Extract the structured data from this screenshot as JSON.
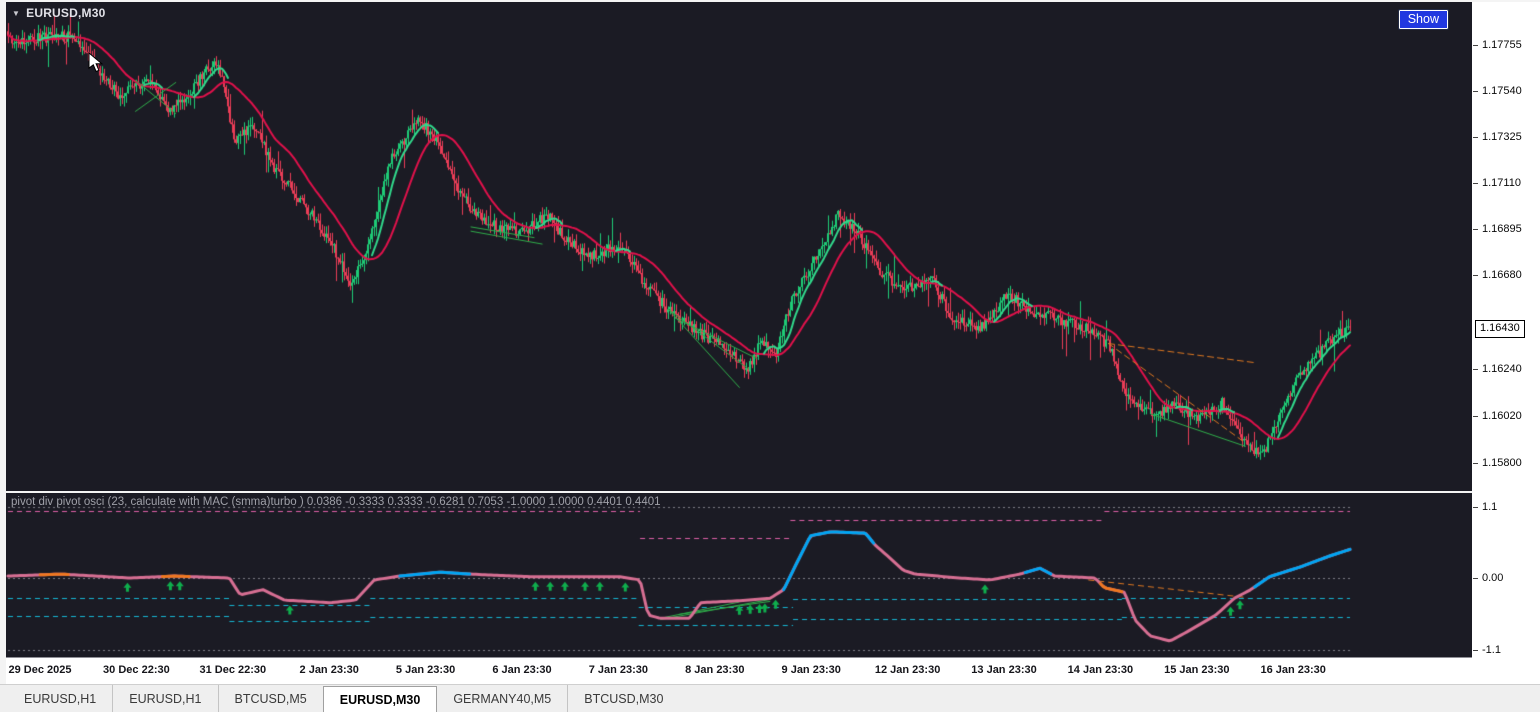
{
  "window": {
    "symbol_label": "EURUSD,M30",
    "show_button_label": "Show"
  },
  "icons": {
    "symbol_dropdown": "▼"
  },
  "main_chart": {
    "price_labels": [
      "1.17755",
      "1.17540",
      "1.17325",
      "1.17110",
      "1.16895",
      "1.16680",
      "1.16240",
      "1.16020",
      "1.15800"
    ],
    "current_price": "1.16430"
  },
  "indicator": {
    "label": "pivot div pivot osci (23, calculate with MAC (smma)turbo ) 0.0386 -0.3333 0.3333 -0.6281 0.7053 -1.0000 1.0000 0.4401 0.4401",
    "scale_labels": [
      "1.1",
      "0.00",
      "-1.1"
    ]
  },
  "time_axis": {
    "labels": [
      "29 Dec 2025",
      "30 Dec 22:30",
      "31 Dec 22:30",
      "2 Jan 23:30",
      "5 Jan 23:30",
      "6 Jan 23:30",
      "7 Jan 23:30",
      "8 Jan 23:30",
      "9 Jan 23:30",
      "12 Jan 23:30",
      "13 Jan 23:30",
      "14 Jan 23:30",
      "15 Jan 23:30",
      "16 Jan 23:30"
    ]
  },
  "tabs": [
    {
      "label": "EURUSD,H1",
      "active": false
    },
    {
      "label": "EURUSD,H1",
      "active": false
    },
    {
      "label": "BTCUSD,M5",
      "active": false
    },
    {
      "label": "EURUSD,M30",
      "active": true
    },
    {
      "label": "GERMANY40,M5",
      "active": false
    },
    {
      "label": "BTCUSD,M30",
      "active": false
    }
  ],
  "colors": {
    "chart_bg": "#1b1b24",
    "bull": "#1ecb76",
    "bear": "#ea3d57",
    "ma_slow": "#e0114b",
    "ma_fast": "#31d98c",
    "osc_line": "#d76f93",
    "osc_blue": "#00a6f4",
    "osc_orange": "#f07820",
    "dashed_magenta": "#df5fa8",
    "dashed_cyan": "#15b7d4",
    "grid_dotted": "#7c7c86",
    "arrow_green": "#0fae4d",
    "div_green": "#2fae4a",
    "div_orange": "#e07820",
    "show_button_bg": "#2138e0"
  },
  "chart_data": [
    {
      "type": "candlestick",
      "symbol": "EURUSD",
      "timeframe": "M30",
      "ylim": [
        1.15685,
        1.179
      ],
      "candle_count": 672,
      "y_tick_labels": [
        "1.17755",
        "1.17540",
        "1.17325",
        "1.17110",
        "1.16895",
        "1.16680",
        "1.16240",
        "1.16020",
        "1.15800"
      ],
      "x_tick_labels": [
        "29 Dec 2025",
        "30 Dec 22:30",
        "31 Dec 22:30",
        "2 Jan 23:30",
        "5 Jan 23:30",
        "6 Jan 23:30",
        "7 Jan 23:30",
        "8 Jan 23:30",
        "9 Jan 23:30",
        "12 Jan 23:30",
        "13 Jan 23:30",
        "14 Jan 23:30",
        "15 Jan 23:30",
        "16 Jan 23:30"
      ],
      "last_price": 1.1643,
      "price_path": [
        [
          0,
          1.17779
        ],
        [
          0.046,
          1.17795
        ],
        [
          0.065,
          1.17662
        ],
        [
          0.083,
          1.17522
        ],
        [
          0.106,
          1.17592
        ],
        [
          0.119,
          1.17442
        ],
        [
          0.132,
          1.17498
        ],
        [
          0.147,
          1.17638
        ],
        [
          0.156,
          1.17685
        ],
        [
          0.169,
          1.17311
        ],
        [
          0.184,
          1.17381
        ],
        [
          0.197,
          1.17194
        ],
        [
          0.218,
          1.17031
        ],
        [
          0.24,
          1.16844
        ],
        [
          0.256,
          1.16634
        ],
        [
          0.27,
          1.16844
        ],
        [
          0.286,
          1.17241
        ],
        [
          0.306,
          1.17405
        ],
        [
          0.32,
          1.17311
        ],
        [
          0.333,
          1.17101
        ],
        [
          0.348,
          1.16961
        ],
        [
          0.367,
          1.169
        ],
        [
          0.385,
          1.16881
        ],
        [
          0.402,
          1.16961
        ],
        [
          0.415,
          1.16844
        ],
        [
          0.434,
          1.16774
        ],
        [
          0.458,
          1.16821
        ],
        [
          0.475,
          1.16634
        ],
        [
          0.492,
          1.16517
        ],
        [
          0.512,
          1.16424
        ],
        [
          0.531,
          1.16354
        ],
        [
          0.551,
          1.16237
        ],
        [
          0.562,
          1.16377
        ],
        [
          0.572,
          1.16307
        ],
        [
          0.584,
          1.16564
        ],
        [
          0.601,
          1.16751
        ],
        [
          0.619,
          1.16961
        ],
        [
          0.633,
          1.16868
        ],
        [
          0.65,
          1.16695
        ],
        [
          0.668,
          1.16611
        ],
        [
          0.689,
          1.16658
        ],
        [
          0.702,
          1.16494
        ],
        [
          0.724,
          1.16424
        ],
        [
          0.745,
          1.16588
        ],
        [
          0.765,
          1.16508
        ],
        [
          0.785,
          1.16471
        ],
        [
          0.806,
          1.16424
        ],
        [
          0.82,
          1.16354
        ],
        [
          0.835,
          1.16106
        ],
        [
          0.852,
          1.16027
        ],
        [
          0.87,
          1.16074
        ],
        [
          0.888,
          1.16003
        ],
        [
          0.905,
          1.16088
        ],
        [
          0.92,
          1.15901
        ],
        [
          0.934,
          1.15825
        ],
        [
          0.946,
          1.16003
        ],
        [
          0.959,
          1.16181
        ],
        [
          0.972,
          1.16274
        ],
        [
          0.985,
          1.16377
        ],
        [
          1,
          1.1643
        ]
      ],
      "green_lines": [
        [
          0.095,
          1.1759,
          0.125,
          1.17435
        ],
        [
          0.095,
          1.17445,
          0.125,
          1.1758
        ],
        [
          0.345,
          1.16905,
          0.392,
          1.16855
        ],
        [
          0.345,
          1.16885,
          0.398,
          1.16825
        ],
        [
          0.492,
          1.1652,
          0.552,
          1.1624
        ],
        [
          0.492,
          1.1652,
          0.545,
          1.16155
        ],
        [
          0.497,
          1.1648,
          0.558,
          1.1629
        ],
        [
          0.852,
          1.1603,
          0.922,
          1.1588
        ]
      ],
      "orange_dashed": [
        [
          0.82,
          1.1636,
          0.93,
          1.1627
        ],
        [
          0.82,
          1.1636,
          0.92,
          1.15905
        ]
      ]
    },
    {
      "type": "line",
      "name": "pivot div pivot osci (23, calculate with MAC (smma)turbo )",
      "last_values": [
        0.0386,
        -0.3333,
        0.3333,
        -0.6281,
        0.7053,
        -1.0,
        1.0,
        0.4401,
        0.4401
      ],
      "ylim": [
        -1.1,
        1.1
      ],
      "y_tick_labels": [
        "1.1",
        "0.00",
        "-1.1"
      ],
      "dotted_levels": [
        1.1,
        0,
        -1.1
      ],
      "path": [
        [
          0,
          0.03
        ],
        [
          0.039,
          0.06
        ],
        [
          0.091,
          0
        ],
        [
          0.124,
          0.03
        ],
        [
          0.165,
          0
        ],
        [
          0.173,
          -0.26
        ],
        [
          0.19,
          -0.18
        ],
        [
          0.206,
          -0.34
        ],
        [
          0.24,
          -0.38
        ],
        [
          0.259,
          -0.34
        ],
        [
          0.273,
          -0.03
        ],
        [
          0.292,
          0.03
        ],
        [
          0.322,
          0.09
        ],
        [
          0.344,
          0.06
        ],
        [
          0.389,
          0.02
        ],
        [
          0.456,
          0.02
        ],
        [
          0.471,
          -0.03
        ],
        [
          0.477,
          -0.57
        ],
        [
          0.486,
          -0.62
        ],
        [
          0.508,
          -0.62
        ],
        [
          0.516,
          -0.38
        ],
        [
          0.545,
          -0.35
        ],
        [
          0.568,
          -0.31
        ],
        [
          0.578,
          -0.18
        ],
        [
          0.587,
          0.2
        ],
        [
          0.598,
          0.65
        ],
        [
          0.613,
          0.71
        ],
        [
          0.639,
          0.69
        ],
        [
          0.646,
          0.51
        ],
        [
          0.657,
          0.31
        ],
        [
          0.667,
          0.12
        ],
        [
          0.676,
          0.06
        ],
        [
          0.709,
          0
        ],
        [
          0.732,
          -0.03
        ],
        [
          0.754,
          0.06
        ],
        [
          0.769,
          0.15
        ],
        [
          0.78,
          0.03
        ],
        [
          0.81,
          0
        ],
        [
          0.817,
          -0.15
        ],
        [
          0.832,
          -0.22
        ],
        [
          0.84,
          -0.65
        ],
        [
          0.851,
          -0.89
        ],
        [
          0.866,
          -0.97
        ],
        [
          0.881,
          -0.8
        ],
        [
          0.9,
          -0.57
        ],
        [
          0.914,
          -0.31
        ],
        [
          0.926,
          -0.18
        ],
        [
          0.94,
          0.02
        ],
        [
          0.963,
          0.17
        ],
        [
          0.985,
          0.34
        ],
        [
          1,
          0.4401
        ]
      ],
      "blue_ranges": [
        [
          0.292,
          0.344
        ],
        [
          0.578,
          0.645
        ],
        [
          0.758,
          0.777
        ],
        [
          0.929,
          1.0
        ]
      ],
      "orange_ranges": [
        [
          0.024,
          0.045
        ],
        [
          0.115,
          0.135
        ],
        [
          0.814,
          0.83
        ]
      ],
      "arrows_up": [
        0.089,
        0.121,
        0.128,
        0.21,
        0.393,
        0.404,
        0.415,
        0.43,
        0.441,
        0.46,
        0.545,
        0.553,
        0.56,
        0.564,
        0.572,
        0.728,
        0.911,
        0.918
      ],
      "magenta_steps": [
        [
          0,
          0.471,
          1.03
        ],
        [
          0.471,
          0.583,
          0.62
        ],
        [
          0.583,
          0.817,
          0.9
        ],
        [
          0.817,
          1,
          1.03
        ]
      ],
      "cyan_steps_upper": [
        [
          0,
          0.165,
          -0.3
        ],
        [
          0.165,
          0.27,
          -0.42
        ],
        [
          0.27,
          0.47,
          -0.3
        ],
        [
          0.47,
          0.585,
          -0.45
        ],
        [
          0.585,
          0.83,
          -0.33
        ],
        [
          0.83,
          1,
          -0.3
        ]
      ],
      "cyan_steps_lower": [
        [
          0,
          0.165,
          -0.58
        ],
        [
          0.165,
          0.27,
          -0.66
        ],
        [
          0.27,
          0.47,
          -0.6
        ],
        [
          0.47,
          0.585,
          -0.72
        ],
        [
          0.585,
          0.83,
          -0.63
        ],
        [
          0.83,
          1,
          -0.6
        ]
      ],
      "green_lines": [
        [
          0.486,
          -0.64,
          0.568,
          -0.33
        ],
        [
          0.486,
          -0.62,
          0.545,
          -0.37
        ],
        [
          0.5,
          -0.56,
          0.568,
          -0.36
        ]
      ],
      "orange_dashed": [
        [
          0.805,
          -0.03,
          0.923,
          -0.3
        ]
      ]
    }
  ]
}
